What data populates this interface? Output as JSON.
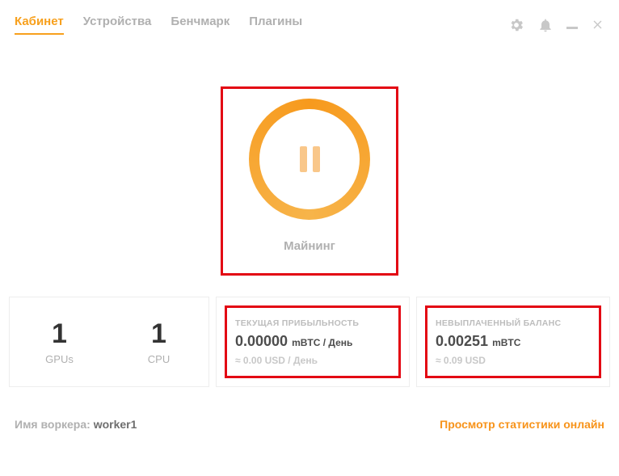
{
  "tabs": {
    "dashboard": "Кабинет",
    "devices": "Устройства",
    "benchmark": "Бенчмарк",
    "plugins": "Плагины"
  },
  "mining": {
    "label": "Майнинг"
  },
  "devices_card": {
    "gpus_count": "1",
    "gpus_label": "GPUs",
    "cpu_count": "1",
    "cpu_label": "CPU"
  },
  "profitability": {
    "title": "ТЕКУЩАЯ ПРИБЫЛЬНОСТЬ",
    "value": "0.00000",
    "unit": "mBTC / День",
    "sub": "≈ 0.00 USD / День"
  },
  "balance": {
    "title": "НЕВЫПЛАЧЕННЫЙ БАЛАНС",
    "value": "0.00251",
    "unit": "mBTC",
    "sub": "≈ 0.09 USD"
  },
  "footer": {
    "worker_label": "Имя воркера: ",
    "worker_name": "worker1",
    "view_stats": "Просмотр статистики онлайн"
  }
}
